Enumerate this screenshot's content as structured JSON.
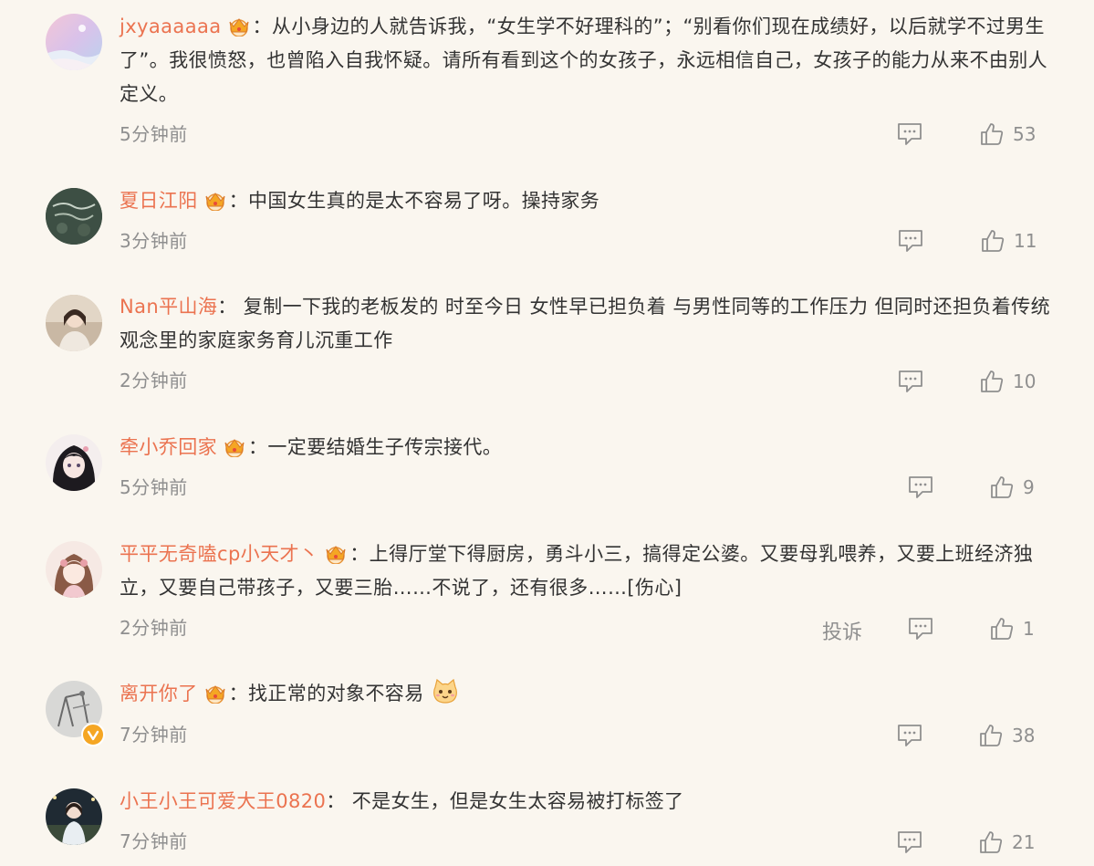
{
  "comments": [
    {
      "user": "jxyaaaaaa",
      "text": "：从小身边的人就告诉我，“女生学不好理科的”；“别看你们现在成绩好，以后就学不过男生了”。我很愤怒，也曾陷入自我怀疑。请所有看到这个的女孩子，永远相信自己，女孩子的能力从来不由别人定义。",
      "time": "5分钟前",
      "likes": "53"
    },
    {
      "user": "夏日江阳",
      "text": "：中国女生真的是太不容易了呀。操持家务",
      "time": "3分钟前",
      "likes": "11"
    },
    {
      "user": "Nan平山海",
      "text": "： 复制一下我的老板发的 时至今日 女性早已担负着 与男性同等的工作压力 但同时还担负着传统观念里的家庭家务育儿沉重工作",
      "time": "2分钟前",
      "likes": "10"
    },
    {
      "user": "牵小乔回家",
      "text": "：一定要结婚生子传宗接代。",
      "time": "5分钟前",
      "likes": "9"
    },
    {
      "user": "平平无奇嗑cp小天才丶",
      "text": "：上得厅堂下得厨房，勇斗小三，搞得定公婆。又要母乳喂养，又要上班经济独立，又要自己带孩子，又要三胎……不说了，还有很多……[伤心]",
      "time": "2分钟前",
      "likes": "1",
      "report": "投诉"
    },
    {
      "user": "离开你了",
      "text": "：找正常的对象不容易",
      "time": "7分钟前",
      "likes": "38"
    },
    {
      "user": "小王小王可爱大王0820",
      "text": "： 不是女生，但是女生太容易被打标签了",
      "time": "7分钟前",
      "likes": "21"
    }
  ],
  "colors": {
    "background": "#faf6ef",
    "username": "#eb7350",
    "meta": "#8f8f8f",
    "crown": "#f5a623",
    "verified": "#f5a623"
  },
  "icons": {
    "reply": "comment-bubble-icon",
    "like": "thumbs-up-icon",
    "member": "crown-member-icon",
    "verified": "verified-v-icon",
    "emoji": "cat-emoji-icon"
  }
}
